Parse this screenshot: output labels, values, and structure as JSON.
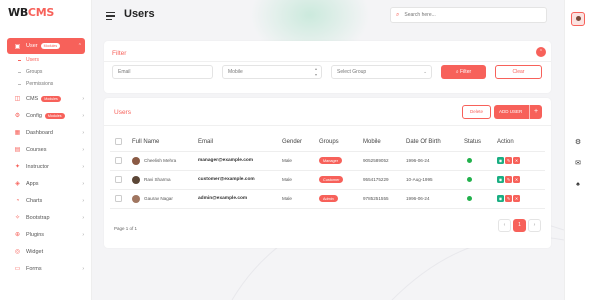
{
  "logo": {
    "text": "WB",
    "accent": "CMS",
    "suffix": ""
  },
  "header": {
    "title": "Users",
    "search_placeholder": "Search here..."
  },
  "sidebar": {
    "items": [
      {
        "label": "User",
        "badge": "Modules",
        "icon": "user-icon",
        "active": true
      },
      {
        "label": "CMS",
        "badge": "Modules",
        "icon": "cms-icon"
      },
      {
        "label": "Config",
        "badge": "Modules",
        "icon": "config-icon"
      },
      {
        "label": "Dashboard",
        "icon": "dashboard-icon"
      },
      {
        "label": "Courses",
        "icon": "courses-icon"
      },
      {
        "label": "Instructor",
        "icon": "instructor-icon"
      },
      {
        "label": "Apps",
        "icon": "apps-icon"
      },
      {
        "label": "Charts",
        "icon": "charts-icon"
      },
      {
        "label": "Bootstrap",
        "icon": "bootstrap-icon"
      },
      {
        "label": "Plugins",
        "icon": "plugins-icon"
      },
      {
        "label": "Widget",
        "icon": "widget-icon"
      },
      {
        "label": "Forms",
        "icon": "forms-icon"
      }
    ],
    "sub_items": [
      {
        "label": "Users",
        "active": true
      },
      {
        "label": "Groups"
      },
      {
        "label": "Permissions"
      }
    ]
  },
  "filter": {
    "title": "Filter",
    "email_placeholder": "Email",
    "mobile_placeholder": "Mobile",
    "group_placeholder": "Select Group",
    "filter_button": "Filter",
    "clear_button": "Clear"
  },
  "users": {
    "title": "Users",
    "delete_button": "Delete",
    "add_button": "ADD USER",
    "add_plus": "+",
    "columns": [
      "Full Name",
      "Email",
      "Gender",
      "Groups",
      "Mobile",
      "Date Of Birth",
      "Status",
      "Action"
    ],
    "rows": [
      {
        "name": "Cheelish Mehra",
        "email": "manager@example.com",
        "gender": "Male",
        "group": "Manager",
        "mobile": "9052589052",
        "dob": "1996-06-24",
        "status_color": "#22b14c"
      },
      {
        "name": "Ravi Sharma",
        "email": "customer@example.com",
        "gender": "Male",
        "group": "Customer",
        "mobile": "9554175229",
        "dob": "10-Aug-1995",
        "status_color": "#22b14c"
      },
      {
        "name": "Gaurav Nagar",
        "email": "admin@example.com",
        "gender": "Male",
        "group": "Admin",
        "mobile": "9785251555",
        "dob": "1996-06-24",
        "status_color": "#22b14c"
      }
    ],
    "page_info": "Page 1 of 1",
    "current_page": "1",
    "prev": "‹",
    "next": "›"
  },
  "colors": {
    "accent": "#f7615a",
    "edit": "#1aae82",
    "delete": "#f7615a"
  }
}
